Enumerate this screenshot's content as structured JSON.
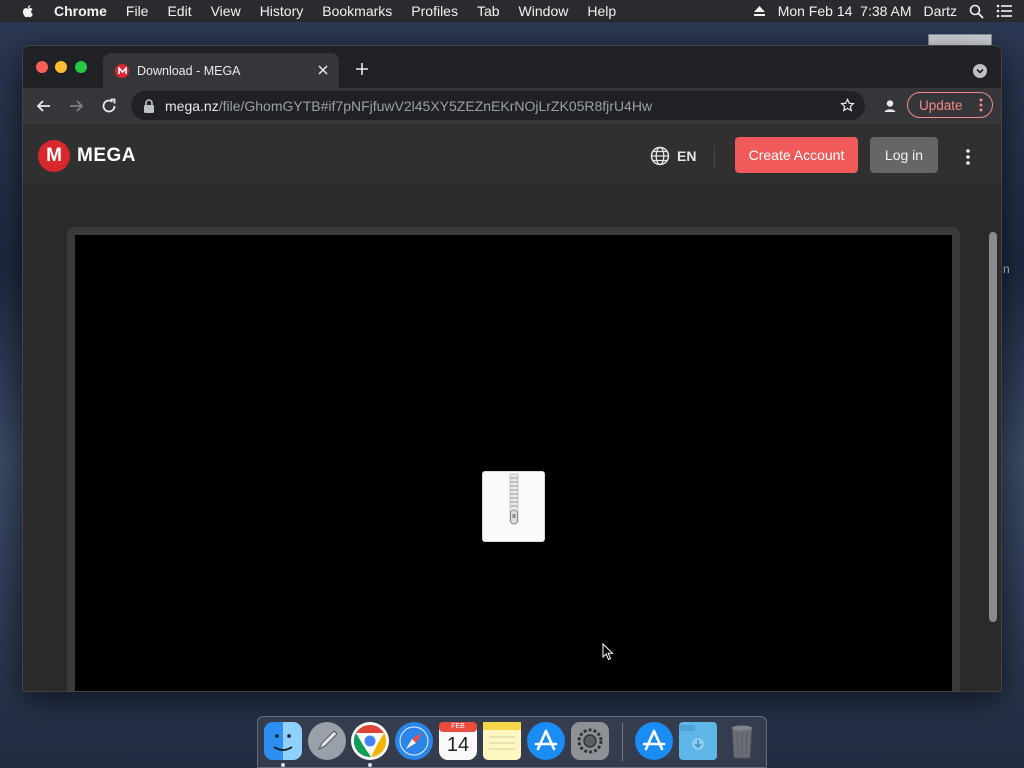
{
  "menubar": {
    "app_name": "Chrome",
    "items": [
      "File",
      "Edit",
      "View",
      "History",
      "Bookmarks",
      "Profiles",
      "Tab",
      "Window",
      "Help"
    ],
    "datetime": "Mon Feb 14  7:38 AM",
    "user": "Dartz"
  },
  "desktop": {
    "partial_label": "n"
  },
  "browser": {
    "tab_title": "Download - MEGA",
    "url_host": "mega.nz",
    "url_path": "/file/GhomGYTB#if7pNFjfuwV2l45XY5ZEZnEKrNOjLrZK05R8fjrU4Hw",
    "update_label": "Update"
  },
  "mega": {
    "logo_letter": "M",
    "logo_text": "MEGA",
    "language": "EN",
    "create_account_label": "Create Account",
    "login_label": "Log in",
    "accent_color": "#f05a5a",
    "preview_icon": "zip-archive-icon"
  },
  "dock": {
    "apps": [
      "finder",
      "launchpad",
      "chrome",
      "safari",
      "calendar",
      "notes",
      "app-store",
      "system-preferences",
      "app-store-2",
      "downloads-folder",
      "trash"
    ],
    "calendar_month": "FEB",
    "calendar_day": "14"
  }
}
